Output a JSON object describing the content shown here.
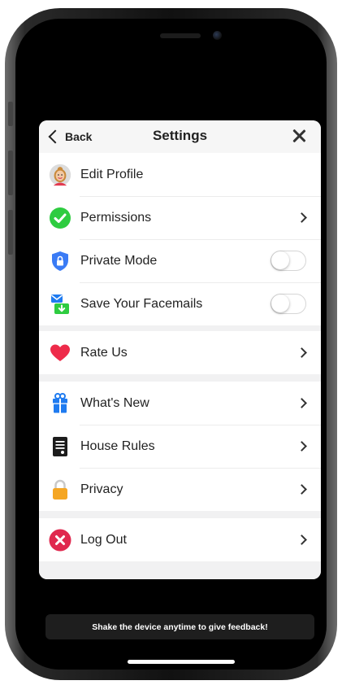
{
  "header": {
    "back_label": "Back",
    "title": "Settings"
  },
  "sections": {
    "account": [
      {
        "label": "Edit Profile",
        "icon": "avatar-icon"
      },
      {
        "label": "Permissions",
        "icon": "checkmark-circle-icon"
      },
      {
        "label": "Private Mode",
        "icon": "shield-icon",
        "toggle": false
      },
      {
        "label": "Save Your Facemails",
        "icon": "download-mail-icon",
        "toggle": false
      }
    ],
    "rate": [
      {
        "label": "Rate Us",
        "icon": "heart-icon"
      }
    ],
    "info": [
      {
        "label": "What's New",
        "icon": "gift-icon"
      },
      {
        "label": "House Rules",
        "icon": "document-icon"
      },
      {
        "label": "Privacy",
        "icon": "lock-icon"
      }
    ],
    "logout": [
      {
        "label": "Log Out",
        "icon": "close-circle-icon"
      }
    ]
  },
  "banner_text": "Shake the device anytime to give feedback!",
  "colors": {
    "permissions_green": "#2ecc40",
    "shield_blue": "#3a7bf5",
    "heart_red": "#ee2b4a",
    "gift_blue": "#1f7bf0",
    "lock_orange": "#f5a623",
    "logout_red": "#e0284e"
  }
}
